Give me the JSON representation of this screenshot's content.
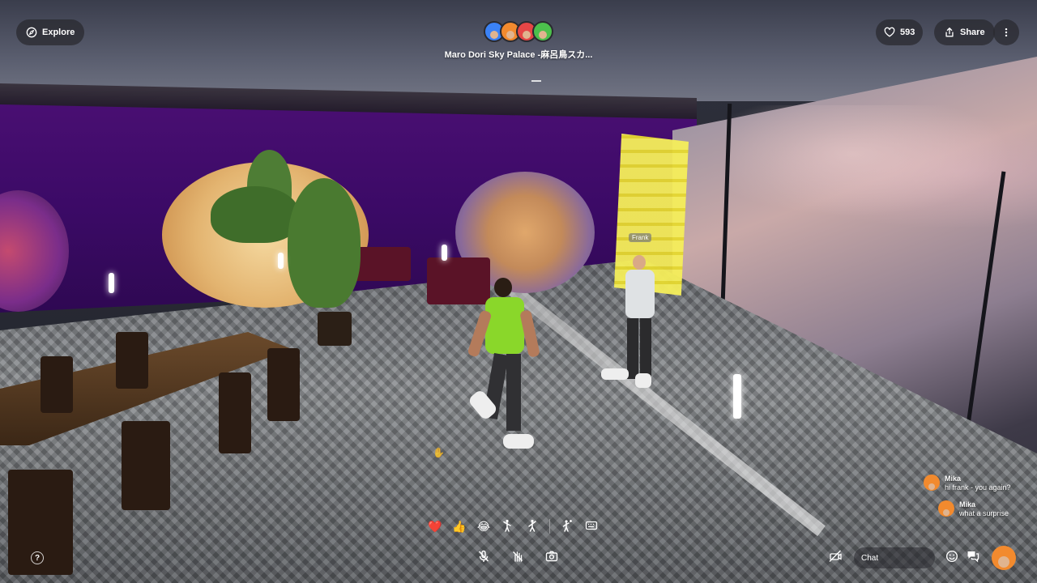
{
  "header": {
    "explore_label": "Explore",
    "likes_count": "593",
    "share_label": "Share",
    "world_title": "Maro Dori Sky Palace -麻呂鳥スカ..."
  },
  "participants": [
    {
      "color": "#3b82f6"
    },
    {
      "color": "#f28a2e"
    },
    {
      "color": "#e64646"
    },
    {
      "color": "#4cc04c"
    }
  ],
  "scene": {
    "player_name_tag": "Frank"
  },
  "chat": {
    "messages": [
      {
        "author": "Mika",
        "text": "hi frank - you again?"
      },
      {
        "author": "Mika",
        "text": "what a surprise"
      }
    ],
    "input_placeholder": "Chat"
  },
  "emotes": [
    {
      "name": "heart-emote",
      "glyph": "❤️"
    },
    {
      "name": "thumbs-up-emote",
      "glyph": "👍"
    },
    {
      "name": "laugh-emote",
      "glyph": "😂"
    }
  ],
  "help": {
    "glyph": "?"
  },
  "colors": {
    "accent": "#f28a2e",
    "pill_bg": "rgba(40,40,46,.72)",
    "wall": "#3b0a66"
  }
}
